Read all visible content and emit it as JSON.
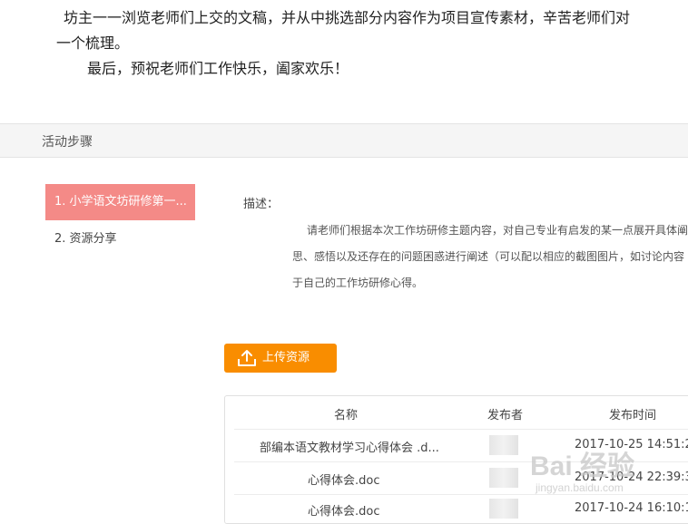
{
  "intro": {
    "line1": "坊主一一浏览老师们上交的文稿，并从中挑选部分内容作为项目宣传素材，辛苦老师们对",
    "line2": "一个梳理。",
    "line3": "最后，预祝老师们工作快乐，阖家欢乐！"
  },
  "steps_header": "活动步骤",
  "sidebar": {
    "items": [
      {
        "label": "1. 小学语文坊研修第一..."
      },
      {
        "label": "2. 资源分享"
      }
    ]
  },
  "description": {
    "label": "描述：",
    "lines": [
      "请老师们根据本次工作坊研修主题内容，对自己专业有启发的某一点展开具体阐",
      "思、感悟以及还存在的问题困惑进行阐述（可以配以相应的截图图片，如讨论内容",
      "于自己的工作坊研修心得。"
    ]
  },
  "upload_button": "上传资源",
  "table": {
    "headers": {
      "name": "名称",
      "publisher": "发布者",
      "time": "发布时间"
    },
    "rows": [
      {
        "name": "部编本语文教材学习心得体会 .d...",
        "time": "2017-10-25 14:51:2"
      },
      {
        "name": "心得体会.doc",
        "time": "2017-10-24 22:39:3"
      },
      {
        "name": "心得体会.doc",
        "time": "2017-10-24 16:10:1"
      }
    ]
  },
  "watermark": {
    "text": "Bai 经验",
    "sub": "jingyan.baidu.com"
  }
}
